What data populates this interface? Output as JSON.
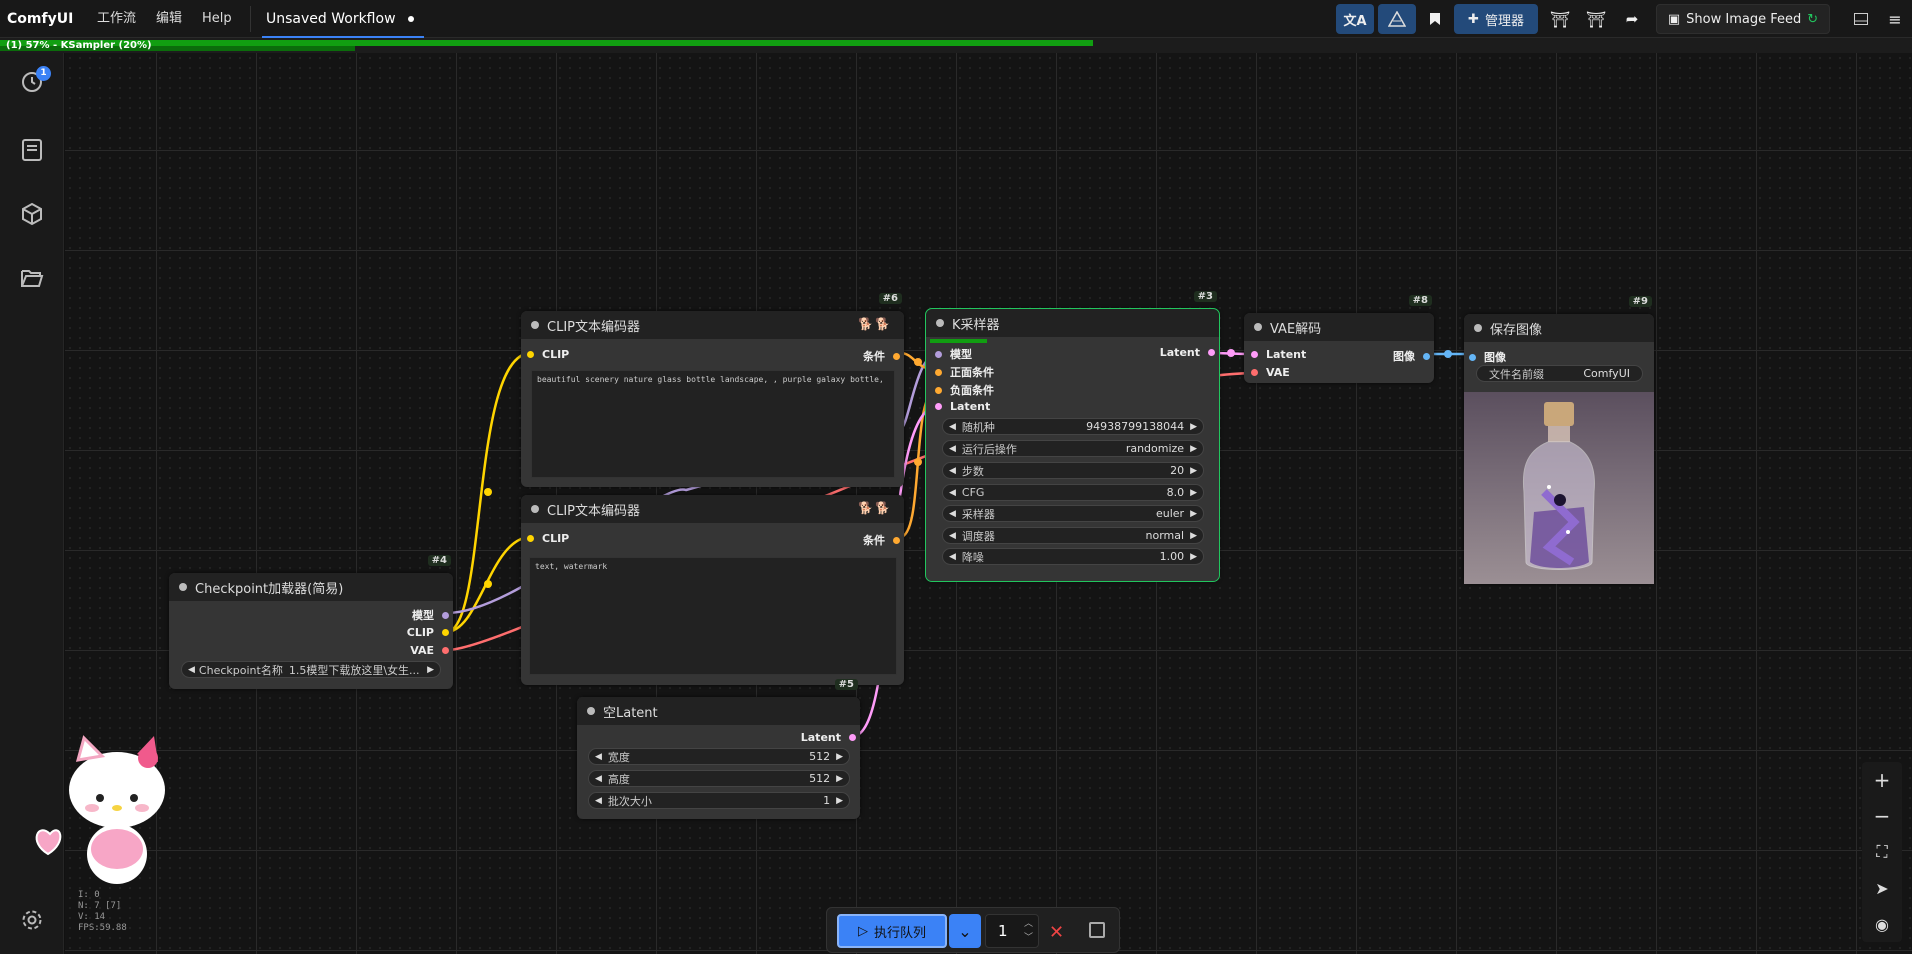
{
  "app": {
    "brand": "ComfyUI"
  },
  "menu": {
    "workflow": "工作流",
    "edit": "编辑",
    "help": "Help"
  },
  "tab": {
    "title": "Unsaved Workflow"
  },
  "toolbar": {
    "manager_label": "管理器",
    "image_feed_label": "Show Image Feed"
  },
  "progress": {
    "text": "(1) 57% - KSampler (20%)",
    "overall_percent": 57,
    "node_percent": 20
  },
  "sidebar": {
    "queue_badge": "1"
  },
  "nodes": {
    "clip_pos": {
      "id": "#6",
      "title": "CLIP文本编码器",
      "input_clip": "CLIP",
      "output": "条件",
      "text": "beautiful scenery nature glass bottle landscape, , purple galaxy bottle,"
    },
    "clip_neg": {
      "id": "",
      "title": "CLIP文本编码器",
      "input_clip": "CLIP",
      "output": "条件",
      "text": "text, watermark"
    },
    "checkpoint": {
      "id": "#4",
      "title": "Checkpoint加载器(简易)",
      "out_model": "模型",
      "out_clip": "CLIP",
      "out_vae": "VAE",
      "widget_label": "Checkpoint名称",
      "widget_value": "1.5模型下载放这里\\女生..."
    },
    "ksampler": {
      "id": "#3",
      "title": "K采样器",
      "in_model": "模型",
      "in_pos": "正面条件",
      "in_neg": "负面条件",
      "in_latent": "Latent",
      "out_latent": "Latent",
      "progress": 0.2,
      "widgets": [
        {
          "label": "随机种",
          "value": "94938799138044"
        },
        {
          "label": "运行后操作",
          "value": "randomize"
        },
        {
          "label": "步数",
          "value": "20"
        },
        {
          "label": "CFG",
          "value": "8.0"
        },
        {
          "label": "采样器",
          "value": "euler"
        },
        {
          "label": "调度器",
          "value": "normal"
        },
        {
          "label": "降噪",
          "value": "1.00"
        }
      ]
    },
    "latent": {
      "id": "#5",
      "title": "空Latent",
      "out_latent": "Latent",
      "widgets": [
        {
          "label": "宽度",
          "value": "512"
        },
        {
          "label": "高度",
          "value": "512"
        },
        {
          "label": "批次大小",
          "value": "1"
        }
      ]
    },
    "vae": {
      "id": "#8",
      "title": "VAE解码",
      "in_latent": "Latent",
      "in_vae": "VAE",
      "out_image": "图像"
    },
    "save": {
      "id": "#9",
      "title": "保存图像",
      "in_image": "图像",
      "prefix_label": "文件名前缀",
      "prefix_value": "ComfyUI"
    }
  },
  "queue": {
    "run_label": "执行队列",
    "count": "1"
  },
  "stats": {
    "l1": "I: 0",
    "l2": "N: 7 [7]",
    "l3": "V: 14",
    "l4": "FPS:59.88"
  },
  "colors": {
    "model": "#b39ddb",
    "clip": "#ffd500",
    "vae": "#ff6e6e",
    "cond": "#ffa931",
    "latent": "#ff9cf9",
    "image": "#64b5f6",
    "accent": "#3b82f6",
    "progress": "#119e11"
  }
}
